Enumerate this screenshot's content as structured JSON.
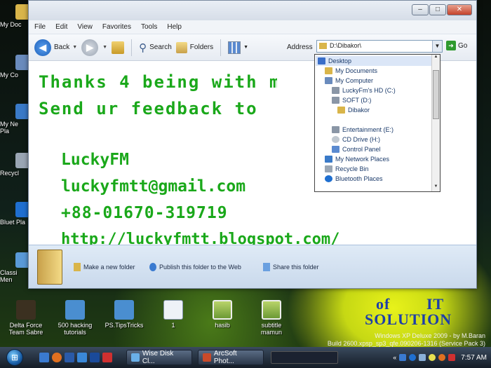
{
  "window": {
    "menu": [
      "File",
      "Edit",
      "View",
      "Favorites",
      "Tools",
      "Help"
    ],
    "toolbar": {
      "back_label": "Back",
      "search_label": "Search",
      "folders_label": "Folders",
      "address_label": "Address",
      "address_value": "D:\\Dibakor\\",
      "go_label": "Go"
    },
    "address_dropdown": [
      {
        "label": "Desktop",
        "icon": "desktop-icon",
        "indent": 0,
        "selected": true
      },
      {
        "label": "My Documents",
        "icon": "folder-icon",
        "indent": 1
      },
      {
        "label": "My Computer",
        "icon": "computer-icon",
        "indent": 1
      },
      {
        "label": "LuckyFm's HD (C:)",
        "icon": "drive-icon",
        "indent": 2
      },
      {
        "label": "SOFT (D:)",
        "icon": "drive-icon",
        "indent": 2
      },
      {
        "label": "Dibakor",
        "icon": "folder-icon",
        "indent": 3
      },
      {
        "label": "Entertainment (E:)",
        "icon": "drive-icon",
        "indent": 2
      },
      {
        "label": "CD Drive (H:)",
        "icon": "cd-icon",
        "indent": 2
      },
      {
        "label": "Control Panel",
        "icon": "control-panel-icon",
        "indent": 2
      },
      {
        "label": "My Network Places",
        "icon": "network-icon",
        "indent": 1
      },
      {
        "label": "Recycle Bin",
        "icon": "recycle-bin-icon",
        "indent": 1
      },
      {
        "label": "Bluetooth Places",
        "icon": "bluetooth-icon",
        "indent": 1
      }
    ],
    "content_lines": [
      "Thanks 4 being with m",
      "Send ur feedback to",
      "LuckyFM",
      "luckyfmtt@gmail.com",
      "+88-01670-319719",
      "http://luckyfmtt.blogspot.com/"
    ],
    "tasks": [
      "Make a new folder",
      "Publish this folder to the Web",
      "Share this folder"
    ]
  },
  "desktop": {
    "left_icons": [
      "My Doc",
      "My Co",
      "My Ne Pla",
      "Recycl",
      "Bluet Pla",
      "Classi Men"
    ],
    "bottom_icons": [
      {
        "label": "Delta Force Team Sabre",
        "icon": "game-icon"
      },
      {
        "label": "500 hacking tutorials",
        "icon": "folder-icon"
      },
      {
        "label": "PS.TipsTricks",
        "icon": "folder-icon"
      },
      {
        "label": "1",
        "icon": "document-icon"
      },
      {
        "label": "hasib",
        "icon": "image-icon"
      },
      {
        "label": "subtitle mamun",
        "icon": "image-icon"
      }
    ],
    "wallpaper_text": [
      "of",
      "IT",
      "SOLUTION"
    ],
    "watermark": [
      "Windows XP Deluxe 2009 - by M.Baran",
      "Build 2600.xpsp_sp3_qfe.090206-1316 (Service Pack 3)"
    ]
  },
  "taskbar": {
    "buttons": [
      "Wise Disk Cl...",
      "ArcSoft Phot..."
    ],
    "clock": "7:57 AM"
  },
  "colors": {
    "accent_text": "#1aa81a",
    "taskbar": "#1f2a38"
  }
}
